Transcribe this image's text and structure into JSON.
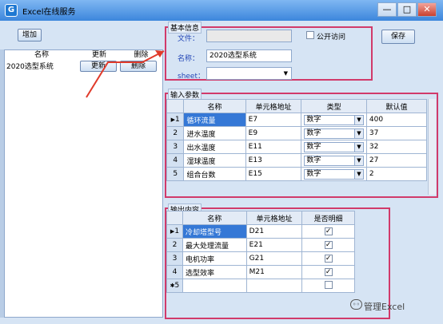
{
  "window": {
    "title": "Excel在线服务",
    "icon_letter": "G",
    "minimize": "—",
    "maximize": "□",
    "close": "✕"
  },
  "toolbar": {
    "add_label": "增加",
    "save_label": "保存"
  },
  "left_grid": {
    "headers": [
      "名称",
      "更新",
      "删除"
    ],
    "rows": [
      {
        "name": "2020选型系统",
        "update": "更新",
        "delete": "删除"
      }
    ]
  },
  "basic_info": {
    "title": "基本信息",
    "file_label": "文件：",
    "file_value": "",
    "public_label": "公开访问",
    "name_label": "名称：",
    "name_value": "2020选型系统",
    "sheet_label": "sheet：",
    "sheet_value": ""
  },
  "input_params": {
    "title": "输入参数",
    "headers": [
      "名称",
      "单元格地址",
      "类型",
      "默认值"
    ],
    "rows": [
      {
        "no": "1",
        "name": "循环流量",
        "cell": "E7",
        "type": "数字",
        "default": "400"
      },
      {
        "no": "2",
        "name": "进水温度",
        "cell": "E9",
        "type": "数字",
        "default": "37"
      },
      {
        "no": "3",
        "name": "出水温度",
        "cell": "E11",
        "type": "数字",
        "default": "32"
      },
      {
        "no": "4",
        "name": "湿球温度",
        "cell": "E13",
        "type": "数字",
        "default": "27"
      },
      {
        "no": "5",
        "name": "组合台数",
        "cell": "E15",
        "type": "数字",
        "default": "2"
      }
    ]
  },
  "output_content": {
    "title": "输出内容",
    "headers": [
      "名称",
      "单元格地址",
      "是否明细"
    ],
    "rows": [
      {
        "no": "1",
        "name": "冷却塔型号",
        "cell": "D21",
        "detail": "✓"
      },
      {
        "no": "2",
        "name": "最大处理流量",
        "cell": "E21",
        "detail": "✓"
      },
      {
        "no": "3",
        "name": "电机功率",
        "cell": "G21",
        "detail": "✓"
      },
      {
        "no": "4",
        "name": "选型效率",
        "cell": "M21",
        "detail": "✓"
      },
      {
        "no": "5",
        "name": "",
        "cell": "",
        "detail": ""
      }
    ]
  },
  "watermark": "管理Excel"
}
